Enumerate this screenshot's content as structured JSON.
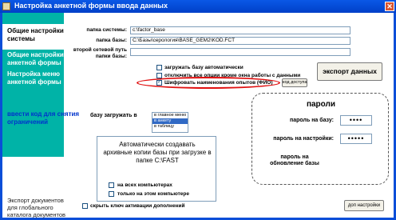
{
  "window": {
    "title": "Настройка анкетной формы ввода данных",
    "close_glyph": "✕"
  },
  "sidebar": {
    "items": [
      {
        "label": "Общие настройки\nсистемы",
        "active": true
      },
      {
        "label": "Общие настройки\nанкетной формы"
      },
      {
        "label": "Настройка меню\nанкетной формы"
      }
    ],
    "secret_hint": "ввести код для снятия\nограничений",
    "footer": "Экспорт документов\nдля глобального\nкаталога документов"
  },
  "paths": {
    "system_label": "папка системы:",
    "system_value": "c:\\factor_base",
    "base_label": "папка базы:",
    "base_value": "C:\\Базы\\серология\\BASE_GEM2\\KOD.FCT",
    "second_label": "второй сетевой путь\nпапки базы:",
    "second_value": ""
  },
  "options": {
    "autoload": {
      "label": "загружать базу автоматически",
      "checked": false
    },
    "disable_all": {
      "label": "отключить все опции кроме окна работы с данными",
      "checked": false
    },
    "encrypt": {
      "label": "Шифровать наименования опытов (ФИО)",
      "checked": true
    },
    "code_button": "код доступа"
  },
  "export_button": "экспорт данных",
  "load_base": {
    "label": "базу загружать в",
    "options": [
      "в главное меню",
      "в анкету",
      "в таблицу"
    ],
    "selected": 1
  },
  "backup": {
    "text": "Автоматически создавать\nархивные копии базы при загрузке в\nпапке C:\\FAST",
    "all_computers": {
      "label": "на всех компьютерах",
      "checked": false
    },
    "this_computer": {
      "label": "только на этом компьютере",
      "checked": false
    }
  },
  "passwords": {
    "title": "пароли",
    "base_label": "пароль на базу:",
    "base_value": "••••",
    "settings_label": "пароль на настройки:",
    "settings_value": "•••••",
    "update_label": "пароль на\nобновление базы"
  },
  "hide_key": {
    "label": "скрыть ключ активации дополнений",
    "checked": false
  },
  "extra_button": "доп настройки"
}
